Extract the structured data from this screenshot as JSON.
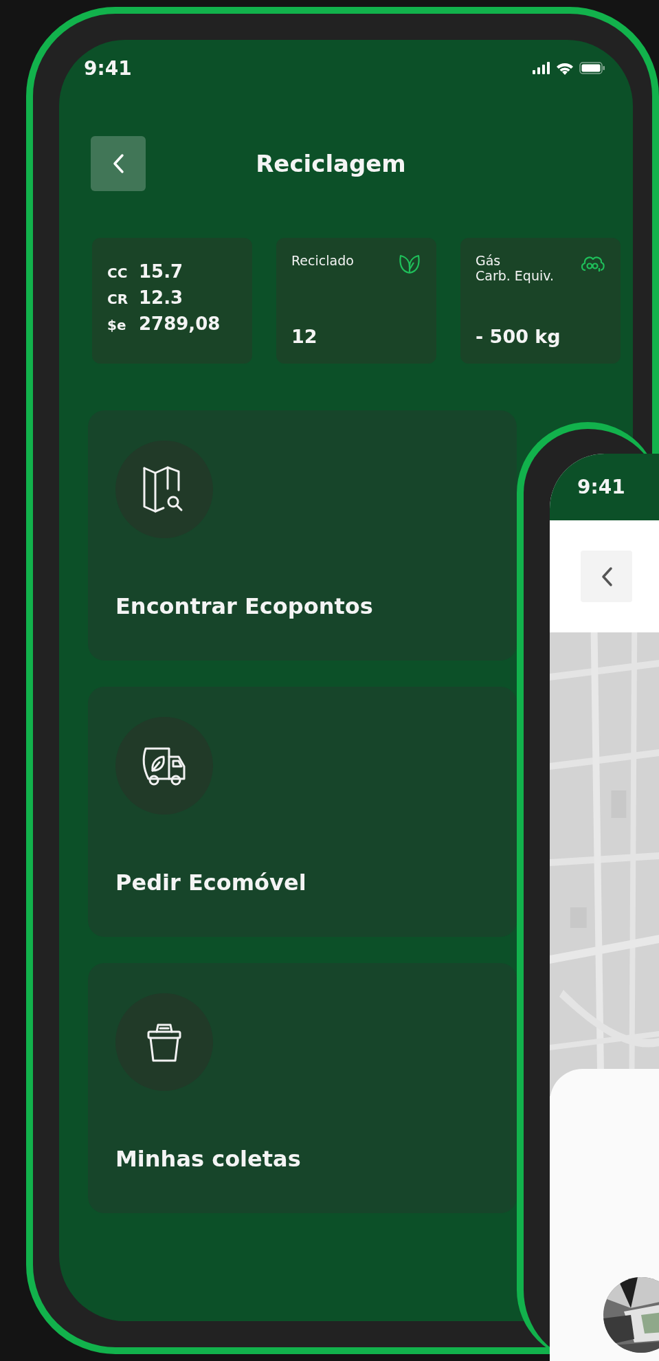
{
  "main_phone": {
    "status_bar": {
      "time": "9:41"
    },
    "header": {
      "title": "Reciclagem"
    },
    "stats": [
      {
        "kind": "balances",
        "rows": [
          {
            "label": "CC",
            "value": "15.7"
          },
          {
            "label": "CR",
            "value": "12.3"
          },
          {
            "label": "$e",
            "value": "2789,08"
          }
        ]
      },
      {
        "kind": "metric",
        "label_lines": [
          "Reciclado"
        ],
        "value": "12"
      },
      {
        "kind": "metric",
        "label_lines": [
          "Gás",
          "Carb. Equiv."
        ],
        "value": "- 500 kg"
      }
    ],
    "menu": [
      {
        "label": "Encontrar Ecopontos"
      },
      {
        "label": "Pedir Ecomóvel"
      },
      {
        "label": "Minhas coletas"
      }
    ]
  },
  "overlay_phone": {
    "status_bar": {
      "time": "9:41"
    }
  }
}
